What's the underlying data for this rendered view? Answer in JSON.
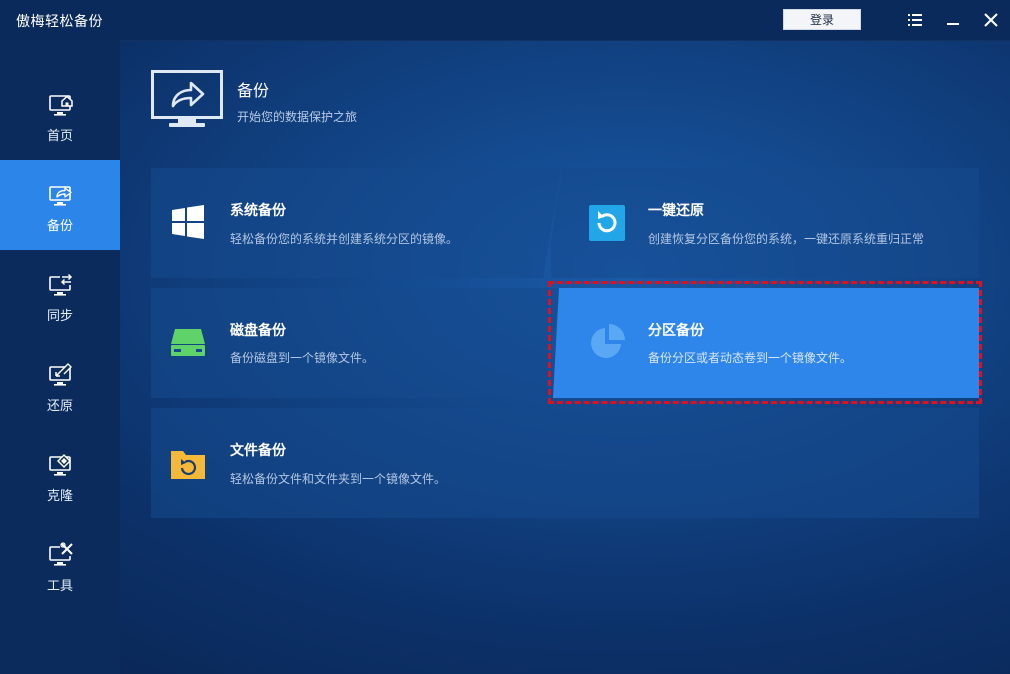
{
  "window": {
    "title": "傲梅轻松备份",
    "login_label": "登录"
  },
  "sidebar": {
    "items": [
      {
        "label": "首页",
        "icon": "home-monitor-icon"
      },
      {
        "label": "备份",
        "icon": "backup-monitor-icon",
        "active": true
      },
      {
        "label": "同步",
        "icon": "sync-monitor-icon"
      },
      {
        "label": "还原",
        "icon": "restore-monitor-icon"
      },
      {
        "label": "克隆",
        "icon": "clone-monitor-icon"
      },
      {
        "label": "工具",
        "icon": "tools-monitor-icon"
      }
    ]
  },
  "header": {
    "title": "备份",
    "subtitle": "开始您的数据保护之旅"
  },
  "cards": {
    "system": {
      "title": "系统备份",
      "desc": "轻松备份您的系统并创建系统分区的镜像。",
      "icon": "windows-logo-icon"
    },
    "restore": {
      "title": "一键还原",
      "desc": "创建恢复分区备份您的系统，一键还原系统重归正常",
      "icon": "one-key-restore-icon"
    },
    "disk": {
      "title": "磁盘备份",
      "desc": "备份磁盘到一个镜像文件。",
      "icon": "disk-drive-icon"
    },
    "partition": {
      "title": "分区备份",
      "desc": "备份分区或者动态卷到一个镜像文件。",
      "icon": "pie-partition-icon"
    },
    "file": {
      "title": "文件备份",
      "desc": "轻松备份文件和文件夹到一个镜像文件。",
      "icon": "folder-sync-icon"
    }
  },
  "colors": {
    "active_blue": "#2c86ea",
    "highlight_card": "#2f86ea",
    "focus_border": "#e0111f",
    "disk_green": "#5fd36a",
    "folder_yellow": "#f5b93a",
    "restore_cyan": "#22a6e8"
  }
}
